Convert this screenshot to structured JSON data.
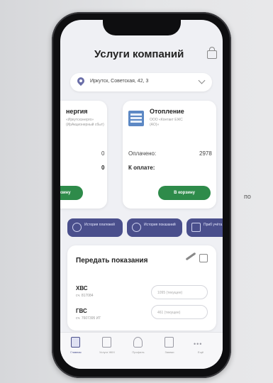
{
  "side_text": "по",
  "header": {
    "title": "Услуги компаний"
  },
  "address": {
    "text": "Иркутск, Советская, 42, 3"
  },
  "cards": {
    "left": {
      "title": "нергия",
      "subtitle": "«Иркутскэнерго» (ИрАкционерный сбыт)",
      "row1_value": "0",
      "row2_value": "0",
      "button": "рзину"
    },
    "right": {
      "title": "Отопление",
      "subtitle": "ООО «Контакт ЕЖС (АО)»",
      "paid_label": "Оплачено:",
      "paid_value": "2978",
      "due_label": "К оплате:",
      "button": "В корзину"
    }
  },
  "history": [
    {
      "label": "История платежей"
    },
    {
      "label": "История показаний"
    },
    {
      "label": "Приб учёта"
    }
  ],
  "meters": {
    "title": "Передать показания",
    "items": [
      {
        "name": "ХВС",
        "number": "сч. 817084",
        "placeholder": "1095 (текущее)"
      },
      {
        "name": "ГВС",
        "number": "сч. 7607395 ИТ",
        "placeholder": "461 (текущее)"
      }
    ]
  },
  "tabbar": [
    {
      "label": "Главная",
      "icon": "home-icon",
      "active": true
    },
    {
      "label": "Услуги ЖКХ",
      "icon": "services-icon",
      "active": false
    },
    {
      "label": "Профиль",
      "icon": "profile-icon",
      "active": false
    },
    {
      "label": "Заявки",
      "icon": "requests-icon",
      "active": false
    },
    {
      "label": "Ещё",
      "icon": "more-icon",
      "active": false
    }
  ],
  "colors": {
    "accent": "#4a4f8c",
    "button_green": "#2e8b4a"
  }
}
